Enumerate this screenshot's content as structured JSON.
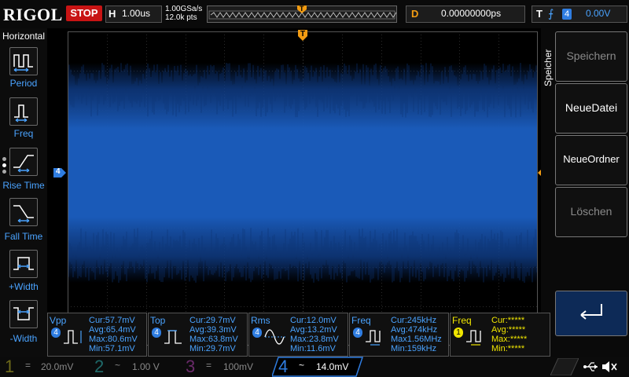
{
  "topbar": {
    "brand": "RIGOL",
    "run_state": "STOP",
    "horizontal_label": "H",
    "timebase": "1.00us",
    "sample_rate": "1.00GSa/s",
    "points": "12.0k pts",
    "delay_label": "D",
    "delay_value": "0.00000000ps",
    "trigger_label": "T",
    "trigger_source": "4",
    "trigger_level": "0.00V",
    "trigger_marker": "T"
  },
  "left_menu": {
    "title": "Horizontal",
    "items": [
      {
        "label": "Period",
        "icon": "period-icon"
      },
      {
        "label": "Freq",
        "icon": "frequency-icon"
      },
      {
        "label": "Rise Time",
        "icon": "rise-time-icon"
      },
      {
        "label": "Fall Time",
        "icon": "fall-time-icon"
      },
      {
        "label": "+Width",
        "icon": "positive-width-icon"
      },
      {
        "label": "-Width",
        "icon": "negative-width-icon"
      }
    ]
  },
  "markers": {
    "channel_offset": "4",
    "trigger_level": "T"
  },
  "right_menu": {
    "title": "Speicher",
    "buttons": [
      {
        "label": "Speichern",
        "state": "disabled"
      },
      {
        "label": "NeueDatei",
        "state": "enabled"
      },
      {
        "label": "NeueOrdner",
        "state": "enabled"
      },
      {
        "label": "Löschen",
        "state": "disabled"
      }
    ],
    "return_icon": "return-arrow-icon"
  },
  "measurements": [
    {
      "name": "Vpp",
      "ch": "4",
      "cur": "Cur:57.7mV",
      "avg": "Avg:65.4mV",
      "max": "Max:80.6mV",
      "min": "Min:57.1mV",
      "color": "#4aa3ff"
    },
    {
      "name": "Top",
      "ch": "4",
      "cur": "Cur:29.7mV",
      "avg": "Avg:39.3mV",
      "max": "Max:63.8mV",
      "min": "Min:29.7mV",
      "color": "#4aa3ff"
    },
    {
      "name": "Rms",
      "ch": "4",
      "cur": "Cur:12.0mV",
      "avg": "Avg:13.2mV",
      "max": "Max:23.8mV",
      "min": "Min:11.6mV",
      "color": "#4aa3ff"
    },
    {
      "name": "Freq",
      "ch": "4",
      "cur": "Cur:245kHz",
      "avg": "Avg:474kHz",
      "max": "Max1.56MHz",
      "min": "Min:159kHz",
      "color": "#4aa3ff"
    },
    {
      "name": "Freq",
      "ch": "1",
      "cur": "Cur:*****",
      "avg": "Avg:*****",
      "max": "Max:*****",
      "min": "Min:*****",
      "color": "#f0e600"
    }
  ],
  "channels": [
    {
      "num": "1",
      "coupling": "=",
      "scale": "20.0mV",
      "color": "#6e6a1a",
      "active": false
    },
    {
      "num": "2",
      "coupling": "~",
      "scale": "1.00 V",
      "color": "#1f6a6a",
      "active": false
    },
    {
      "num": "3",
      "coupling": "=",
      "scale": "100mV",
      "color": "#6a2a6a",
      "active": false
    },
    {
      "num": "4",
      "coupling": "~",
      "scale": "14.0mV",
      "color": "#2f7de1",
      "active": true
    }
  ],
  "status_icons": [
    "usb-icon",
    "speaker-muted-icon"
  ],
  "colors": {
    "trace": "#1e66c9",
    "trigger": "#f39c12",
    "stop": "#c81414",
    "ch1": "#f0e600",
    "ch4": "#2f7de1"
  }
}
